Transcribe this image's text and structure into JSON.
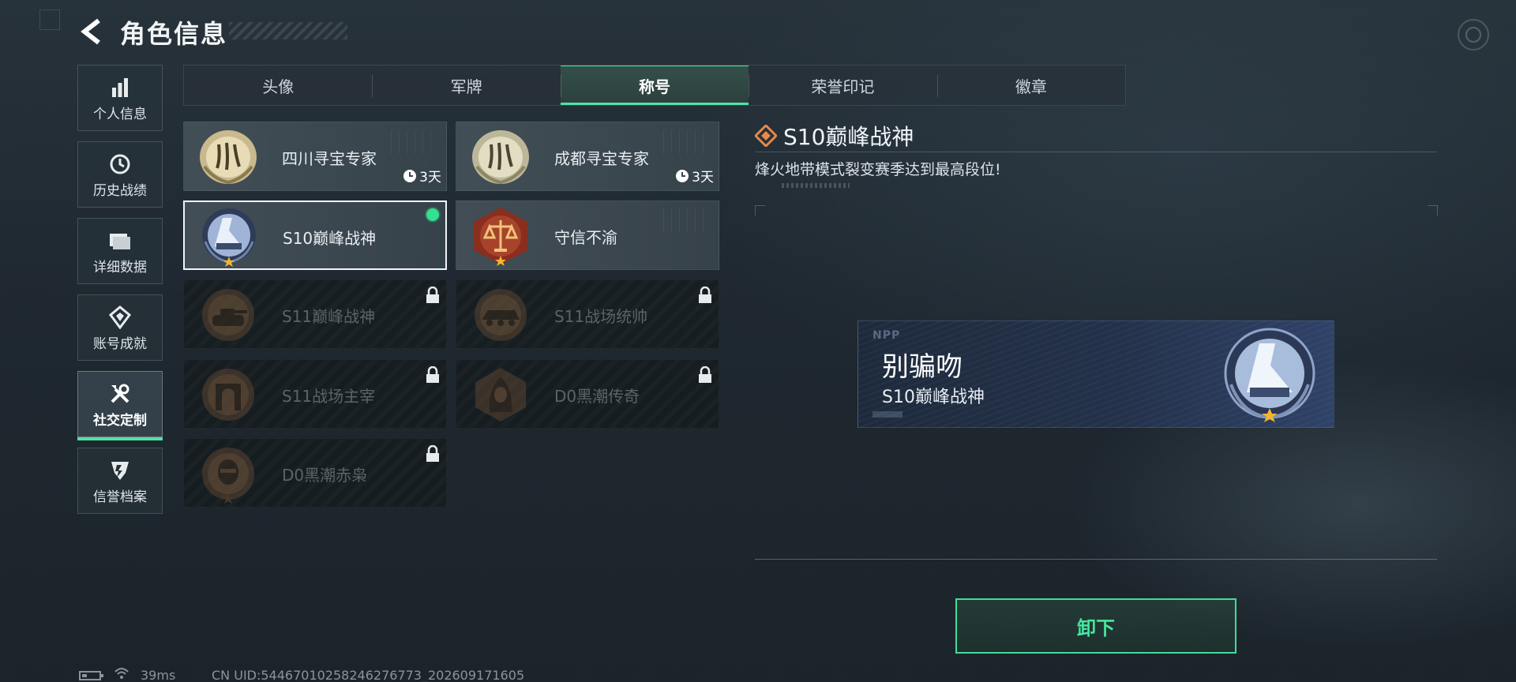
{
  "header": {
    "title": "角色信息"
  },
  "sidebar": {
    "items": [
      {
        "label": "个人信息",
        "icon": "bar-chart-icon"
      },
      {
        "label": "历史战绩",
        "icon": "clock-icon"
      },
      {
        "label": "详细数据",
        "icon": "folder-icon"
      },
      {
        "label": "账号成就",
        "icon": "achievement-icon"
      },
      {
        "label": "社交定制",
        "icon": "tools-icon",
        "active": true
      },
      {
        "label": "信誉档案",
        "icon": "credit-shield-icon"
      }
    ]
  },
  "tabs": [
    {
      "label": "头像"
    },
    {
      "label": "军牌"
    },
    {
      "label": "称号",
      "active": true
    },
    {
      "label": "荣誉印记"
    },
    {
      "label": "徽章"
    }
  ],
  "titles": [
    {
      "name": "四川寻宝专家",
      "timer": "3天",
      "state": "unlocked",
      "medal": "sichuan-medal-icon"
    },
    {
      "name": "成都寻宝专家",
      "timer": "3天",
      "state": "unlocked",
      "medal": "chengdu-medal-icon"
    },
    {
      "name": "S10巅峰战神",
      "state": "selected",
      "equipped": true,
      "medal": "s10-peak-medal-icon"
    },
    {
      "name": "守信不渝",
      "state": "unlocked",
      "medal": "scales-medal-icon"
    },
    {
      "name": "S11巅峰战神",
      "state": "locked",
      "medal": "tank-medal-icon"
    },
    {
      "name": "S11战场统帅",
      "state": "locked",
      "medal": "apc-medal-icon"
    },
    {
      "name": "S11战场主宰",
      "state": "locked",
      "medal": "arch-medal-icon"
    },
    {
      "name": "D0黑潮传奇",
      "state": "locked",
      "medal": "hooded-medal-icon"
    },
    {
      "name": "D0黑潮赤枭",
      "state": "locked",
      "medal": "masked-medal-icon"
    }
  ],
  "detail": {
    "title": "S10巅峰战神",
    "description": "烽火地带模式裂变赛季达到最高段位!"
  },
  "preview": {
    "logo": "NPP",
    "player_name": "别骗吻",
    "title": "S10巅峰战神"
  },
  "actions": {
    "unequip_label": "卸下"
  },
  "status": {
    "battery_level": 0.3,
    "ping": "39ms",
    "uid": "CN UID:5446701025824627677​3_202609171605"
  },
  "colors": {
    "accent": "#4fe3a6",
    "equipped_dot": "#33e08f",
    "star": "#f2b531"
  }
}
